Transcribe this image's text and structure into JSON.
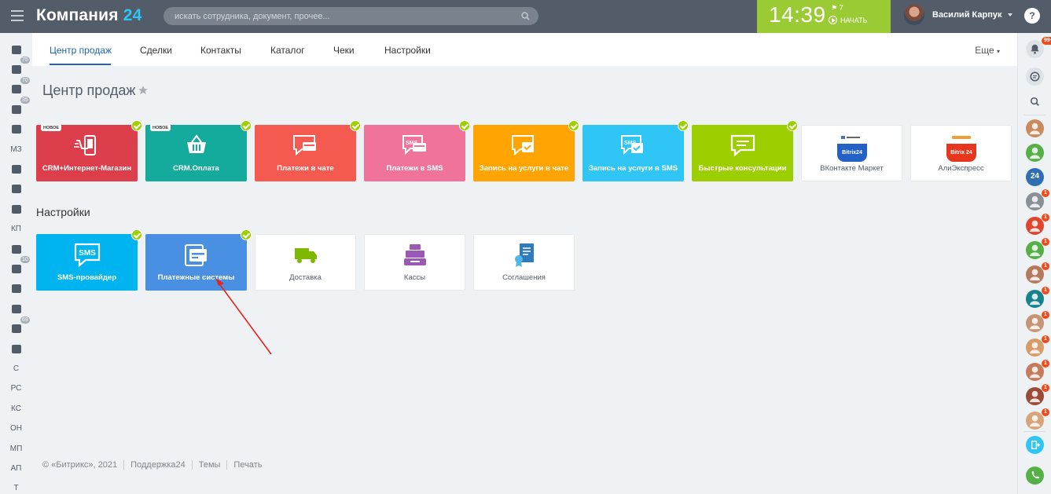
{
  "header": {
    "logo_text": "Компания",
    "logo_num": "24",
    "search_placeholder": "искать сотрудника, документ, прочее...",
    "time": "14:39",
    "flag_count": "7",
    "start_label": "НАЧАТЬ",
    "user_name": "Василий Карпук",
    "help_label": "?"
  },
  "left_sidebar": [
    {
      "icon": "news-icon"
    },
    {
      "icon": "filter-icon",
      "badge": "75"
    },
    {
      "icon": "tasks-icon",
      "badge": "70"
    },
    {
      "icon": "sync-icon",
      "badge": "35"
    },
    {
      "icon": "clock-icon"
    },
    {
      "text": "МЗ"
    },
    {
      "icon": "contact-card-icon"
    },
    {
      "icon": "buildings-icon"
    },
    {
      "icon": "calendar-icon"
    },
    {
      "text": "КП"
    },
    {
      "icon": "drive-icon"
    },
    {
      "icon": "chat-icon",
      "badge": "10"
    },
    {
      "icon": "group-icon"
    },
    {
      "icon": "tools-icon"
    },
    {
      "icon": "mail-icon",
      "badge": "69"
    },
    {
      "icon": "box-icon"
    },
    {
      "text": "С"
    },
    {
      "text": "РС"
    },
    {
      "text": "КС"
    },
    {
      "text": "ОН"
    },
    {
      "text": "МП"
    },
    {
      "text": "АП"
    },
    {
      "text": "Т"
    }
  ],
  "right_sidebar": {
    "notifications_badge": "99+",
    "contacts": [
      {
        "color": "#c98b5e",
        "badge": ""
      },
      {
        "color": "#55b046",
        "badge": ""
      },
      {
        "color": "#2e6fb4",
        "badge": "",
        "label": "24"
      },
      {
        "color": "#8a9098",
        "badge": "1"
      },
      {
        "color": "#e1452d",
        "badge": "1"
      },
      {
        "color": "#55b046",
        "badge": "1"
      },
      {
        "color": "#b57a5d",
        "badge": "1"
      },
      {
        "color": "#16838c",
        "badge": "1"
      },
      {
        "color": "#c89473",
        "badge": "1"
      },
      {
        "color": "#d99b6a",
        "badge": "1"
      },
      {
        "color": "#c67b5a",
        "badge": "1"
      },
      {
        "color": "#9b4b35",
        "badge": "1"
      },
      {
        "color": "#d8a57a",
        "badge": "1"
      }
    ]
  },
  "tabs": [
    "Центр продаж",
    "Сделки",
    "Контакты",
    "Каталог",
    "Чеки",
    "Настройки"
  ],
  "more_label": "Еще",
  "page_title": "Центр продаж",
  "tiles_top": [
    {
      "label": "CRM+Интернет-Магазин",
      "color": "#dc3e4b",
      "icon": "mobile-shop-icon",
      "new": true,
      "checked": true
    },
    {
      "label": "CRM.Оплата",
      "color": "#14aa9c",
      "icon": "basket-icon",
      "new": true,
      "checked": true
    },
    {
      "label": "Платежи в чате",
      "color": "#f55a50",
      "icon": "chat-card-icon",
      "new": false,
      "checked": true
    },
    {
      "label": "Платежи в SMS",
      "color": "#f0739b",
      "icon": "sms-card-icon",
      "new": false,
      "checked": true
    },
    {
      "label": "Запись на услуги в чате",
      "color": "#ffa400",
      "icon": "chat-booking-icon",
      "new": false,
      "checked": true
    },
    {
      "label": "Запись на услуги в SMS",
      "color": "#2fc6f6",
      "icon": "sms-booking-icon",
      "new": false,
      "checked": true
    },
    {
      "label": "Быстрые консультации",
      "color": "#9dcf00",
      "icon": "chat-lines-icon",
      "new": false,
      "checked": true
    },
    {
      "label": "ВКонтакте Маркет",
      "color": "#ffffff",
      "icon": "vk-market-icon",
      "new": false,
      "checked": false
    },
    {
      "label": "АлиЭкспресс",
      "color": "#ffffff",
      "icon": "aliexpress-icon",
      "new": false,
      "checked": false
    }
  ],
  "new_badge": "НОВОЕ",
  "vk_icon_text": "Bitrix24",
  "ali_icon_text": "Bitrix 24",
  "section_title": "Настройки",
  "tiles_settings": [
    {
      "label": "SMS-провайдер",
      "color": "#00b4f0",
      "icon": "sms-icon",
      "checked": true
    },
    {
      "label": "Платежные системы",
      "color": "#4a90e2",
      "icon": "cards-icon",
      "checked": true
    },
    {
      "label": "Доставка",
      "color": "#ffffff",
      "icon": "truck-icon",
      "checked": false
    },
    {
      "label": "Кассы",
      "color": "#ffffff",
      "icon": "cash-register-icon",
      "checked": false
    },
    {
      "label": "Соглашения",
      "color": "#ffffff",
      "icon": "agreement-icon",
      "checked": false
    }
  ],
  "footer": [
    "© «Битрикс», 2021",
    "Поддержка24",
    "Темы",
    "Печать"
  ]
}
